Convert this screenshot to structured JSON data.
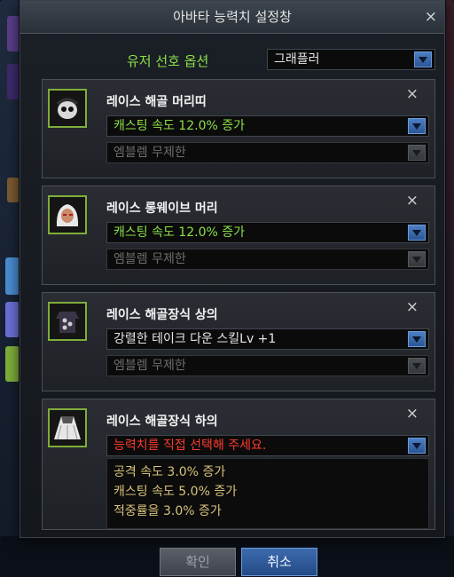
{
  "window": {
    "title": "아바타 능력치 설정창",
    "close_glyph": "×"
  },
  "user_preference": {
    "label": "유저 선호 옵션",
    "selected": "그래플러"
  },
  "items": [
    {
      "name": "레이스 해골 머리띠",
      "option": "캐스팅 속도 12.0% 증가",
      "emblem": "엠블렘 무제한",
      "icon": "skull-headband-icon"
    },
    {
      "name": "레이스 롱웨이브 머리",
      "option": "캐스팅 속도 12.0% 증가",
      "emblem": "엠블렘 무제한",
      "icon": "long-wave-hair-icon"
    },
    {
      "name": "레이스 해골장식 상의",
      "option": "강렬한 테이크 다운 스킬Lv +1",
      "emblem": "엠블렘 무제한",
      "icon": "skull-top-icon"
    },
    {
      "name": "레이스 해골장식 하의",
      "option": "능력치를 직접 선택해 주세요.",
      "icon": "skull-bottom-icon",
      "dropdown_options": [
        "공격 속도 3.0% 증가",
        "캐스팅 속도 5.0% 증가",
        "적중률을 3.0% 증가"
      ]
    }
  ],
  "buttons": {
    "confirm": "확인",
    "cancel": "취소"
  },
  "colors": {
    "accent_green": "#8de04a",
    "warning_red": "#ff3b2e",
    "option_gold": "#d8c27a",
    "button_blue": "#2f5c9f"
  }
}
